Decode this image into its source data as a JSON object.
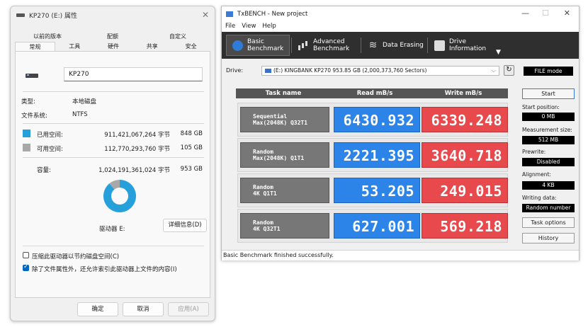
{
  "props": {
    "title": "KP270 (E:) 属性",
    "tabs_row1": [
      "以前的版本",
      "配额",
      "自定义"
    ],
    "tabs_row2": [
      "常规",
      "工具",
      "硬件",
      "共享",
      "安全"
    ],
    "active_tab": "常规",
    "drive_name": "KP270",
    "type_label": "类型:",
    "type_value": "本地磁盘",
    "fs_label": "文件系统:",
    "fs_value": "NTFS",
    "used_label": "已用空间:",
    "used_bytes": "911,421,067,264 字节",
    "used_gb": "848 GB",
    "free_label": "可用空间:",
    "free_bytes": "112,770,293,760 字节",
    "free_gb": "105 GB",
    "cap_label": "容量:",
    "cap_bytes": "1,024,191,361,024 字节",
    "cap_gb": "953 GB",
    "used_fraction": 0.89,
    "drive_letter": "驱动器 E:",
    "details_button": "详细信息(D)",
    "compress_label": "压缩此驱动器以节约磁盘空间(C)",
    "compress_checked": false,
    "index_label": "除了文件属性外，还允许索引此驱动器上文件的内容(I)",
    "index_checked": true,
    "ok": "确定",
    "cancel": "取消",
    "apply": "应用(A)",
    "colors": {
      "used": "#26a0da",
      "free": "#a8a8a8"
    }
  },
  "tx": {
    "title": "TxBENCH - New project",
    "menu": [
      "File",
      "View",
      "Help"
    ],
    "toolbar": [
      {
        "line1": "Basic",
        "line2": "Benchmark",
        "icon": "stopwatch-icon",
        "active": true
      },
      {
        "line1": "Advanced",
        "line2": "Benchmark",
        "icon": "bar-chart-icon",
        "active": false
      },
      {
        "line1": "Data Erasing",
        "line2": "",
        "icon": "eraser-icon",
        "active": false
      },
      {
        "line1": "Drive",
        "line2": "Information",
        "icon": "drive-info-icon",
        "active": false
      }
    ],
    "drive_label": "Drive:",
    "drive_value": "(E:) KINGBANK KP270  953.85 GB (2,000,373,760 Sectors)",
    "mode": "FILE mode",
    "headers": [
      "Task name",
      "Read mB/s",
      "Write mB/s"
    ],
    "rows": [
      {
        "name1": "Sequential",
        "name2": "Max(2048K) Q32T1",
        "read": "6430.932",
        "write": "6339.248"
      },
      {
        "name1": "Random",
        "name2": "Max(2048K) Q1T1",
        "read": "2221.395",
        "write": "3640.718"
      },
      {
        "name1": "Random",
        "name2": "4K Q1T1",
        "read": "53.205",
        "write": "249.015"
      },
      {
        "name1": "Random",
        "name2": "4K Q32T1",
        "read": "627.001",
        "write": "569.218"
      }
    ],
    "start": "Start",
    "start_pos_label": "Start position:",
    "start_pos": "0 MB",
    "size_label": "Measurement size:",
    "size": "512 MB",
    "prewrite_label": "Prewrite:",
    "prewrite": "Disabled",
    "align_label": "Alignment:",
    "align": "4 KB",
    "wdata_label": "Writing data:",
    "wdata": "Random number",
    "task_options": "Task options",
    "history": "History",
    "status": "Basic Benchmark finished successfully.",
    "colors": {
      "read": "#2c84e8",
      "write": "#e7494d"
    }
  }
}
